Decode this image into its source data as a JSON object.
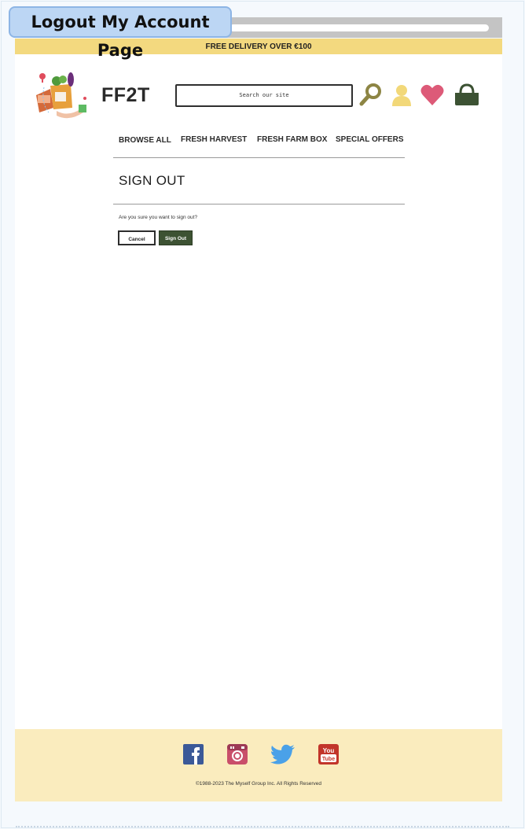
{
  "window": {
    "title": "Logout My Account Page"
  },
  "banner": {
    "text": "FREE DELIVERY OVER €100"
  },
  "header": {
    "brand": "FF2T",
    "search_placeholder": "Search our site",
    "icons": [
      "search-icon",
      "account-icon",
      "heart-icon",
      "basket-icon"
    ]
  },
  "nav": {
    "items": [
      {
        "label": "BROWSE ALL"
      },
      {
        "label": "FRESH HARVEST"
      },
      {
        "label": "FRESH FARM BOX"
      },
      {
        "label": "SPECIAL OFFERS"
      }
    ]
  },
  "main": {
    "heading": "SIGN OUT",
    "question": "Are you sure you want to sign out?",
    "cancel_label": "Cancel",
    "signout_label": "Sign Out"
  },
  "footer": {
    "social": [
      "facebook-icon",
      "instagram-icon",
      "twitter-icon",
      "youtube-icon"
    ],
    "copyright": "©1988-2023 The Myself Group Inc. All Rights Reserved"
  },
  "colors": {
    "banner": "#f3d97f",
    "footer": "#faecbe",
    "primary_button": "#3d5233",
    "search_icon": "#8d8544",
    "account_icon": "#f2d879",
    "heart_icon": "#dd5a78",
    "basket_icon": "#3c5233"
  }
}
